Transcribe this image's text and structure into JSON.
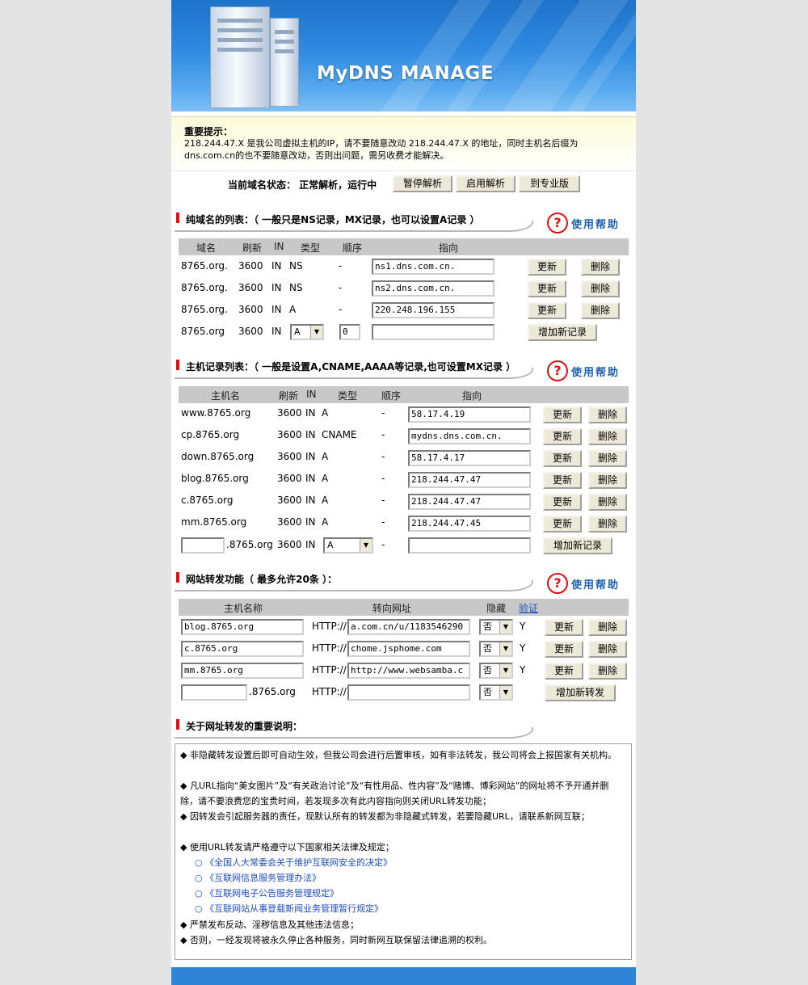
{
  "banner": {
    "title": "MyDNS MANAGE"
  },
  "notice": {
    "heading": "重要提示：",
    "body": "218.244.47.X 是我公司虚拟主机的IP，请不要随意改动 218.244.47.X 的地址，同时主机名后缀为 dns.com.cn的也不要随意改动，否则出问题，需另收费才能解决。"
  },
  "status": {
    "label": "当前域名状态： 正常解析，运行中",
    "buttons": [
      "暂停解析",
      "启用解析",
      "到专业版"
    ]
  },
  "help_label": "使用帮助",
  "help_glyph": "?",
  "domain_section": {
    "title": "纯域名的列表：（ 一般只是NS记录，MX记录，也可以设置A记录 ）",
    "headers": [
      "域名",
      "刷新",
      "IN",
      "类型",
      "顺序",
      "指向"
    ],
    "rows": [
      {
        "name": "8765.org.",
        "ttl": "3600",
        "in": "IN",
        "type": "NS",
        "order": "-",
        "target": "ns1.dns.com.cn."
      },
      {
        "name": "8765.org.",
        "ttl": "3600",
        "in": "IN",
        "type": "NS",
        "order": "-",
        "target": "ns2.dns.com.cn."
      },
      {
        "name": "8765.org.",
        "ttl": "3600",
        "in": "IN",
        "type": "A",
        "order": "-",
        "target": "220.248.196.155"
      }
    ],
    "new_row": {
      "name": "8765.org",
      "ttl": "3600",
      "in": "IN",
      "type": "A",
      "order": "0",
      "target": ""
    },
    "update_label": "更新",
    "delete_label": "删除",
    "add_label": "增加新记录"
  },
  "host_section": {
    "title": "主机记录列表：（ 一般是设置A,CNAME,AAAA等记录,也可设置MX记录 ）",
    "headers": [
      "主机名",
      "刷新",
      "IN",
      "类型",
      "顺序",
      "指向"
    ],
    "rows": [
      {
        "name": "www.8765.org",
        "ttl": "3600",
        "in": "IN",
        "type": "A",
        "order": "-",
        "target": "58.17.4.19"
      },
      {
        "name": "cp.8765.org",
        "ttl": "3600",
        "in": "IN",
        "type": "CNAME",
        "order": "-",
        "target": "mydns.dns.com.cn."
      },
      {
        "name": "down.8765.org",
        "ttl": "3600",
        "in": "IN",
        "type": "A",
        "order": "-",
        "target": "58.17.4.17"
      },
      {
        "name": "blog.8765.org",
        "ttl": "3600",
        "in": "IN",
        "type": "A",
        "order": "-",
        "target": "218.244.47.47"
      },
      {
        "name": "c.8765.org",
        "ttl": "3600",
        "in": "IN",
        "type": "A",
        "order": "-",
        "target": "218.244.47.47"
      },
      {
        "name": "mm.8765.org",
        "ttl": "3600",
        "in": "IN",
        "type": "A",
        "order": "-",
        "target": "218.244.47.45"
      }
    ],
    "new_row": {
      "host": "",
      "suffix": ".8765.org",
      "ttl": "3600",
      "in": "IN",
      "type": "A",
      "order": "-",
      "target": ""
    },
    "update_label": "更新",
    "delete_label": "删除",
    "add_label": "增加新记录"
  },
  "forward_section": {
    "title": "网站转发功能（ 最多允许20条 ）：",
    "headers": [
      "主机名称",
      "转向网址",
      "隐藏",
      "验证"
    ],
    "rows": [
      {
        "host": "blog.8765.org",
        "proto": "HTTP://",
        "url": "a.com.cn/u/1183546290",
        "hidden": "否",
        "verify": "Y"
      },
      {
        "host": "c.8765.org",
        "proto": "HTTP://",
        "url": "chome.jsphome.com",
        "hidden": "否",
        "verify": "Y"
      },
      {
        "host": "mm.8765.org",
        "proto": "HTTP://",
        "url": "http://www.websamba.c",
        "hidden": "否",
        "verify": "Y"
      }
    ],
    "new_row": {
      "host": "",
      "suffix": ".8765.org",
      "proto": "HTTP://",
      "url": "",
      "hidden": "否"
    },
    "update_label": "更新",
    "delete_label": "删除",
    "add_label": "增加新转发"
  },
  "notes_section": {
    "title": "关于网址转发的重要说明：",
    "bullet": "◆",
    "law_bullet": "○",
    "items": [
      "非隐藏转发设置后即可自动生效，但我公司会进行后置审核，如有非法转发，我公司将会上报国家有关机构。",
      "凡URL指向“美女图片”及“有关政治讨论”及“有性用品、性内容”及“赌博、博彩网站”的网址将不予开通并删除，请不要浪费您的宝贵时间，若发现多次有此内容指向则关闭URL转发功能；",
      "因转发会引起服务器的责任，现默认所有的转发都为非隐藏式转发，若要隐藏URL，请联系新网互联；",
      "使用URL转发请严格遵守以下国家相关法律及规定；",
      "严禁发布反动、淫秽信息及其他违法信息；",
      "否则，一经发现将被永久停止各种服务，同时新网互联保留法律追溯的权利。"
    ],
    "laws": [
      "《全国人大常委会关于维护互联网安全的决定》",
      "《互联网信息服务管理办法》",
      "《互联网电子公告服务管理规定》",
      "《互联网站从事登载新闻业务管理暂行规定》"
    ]
  }
}
